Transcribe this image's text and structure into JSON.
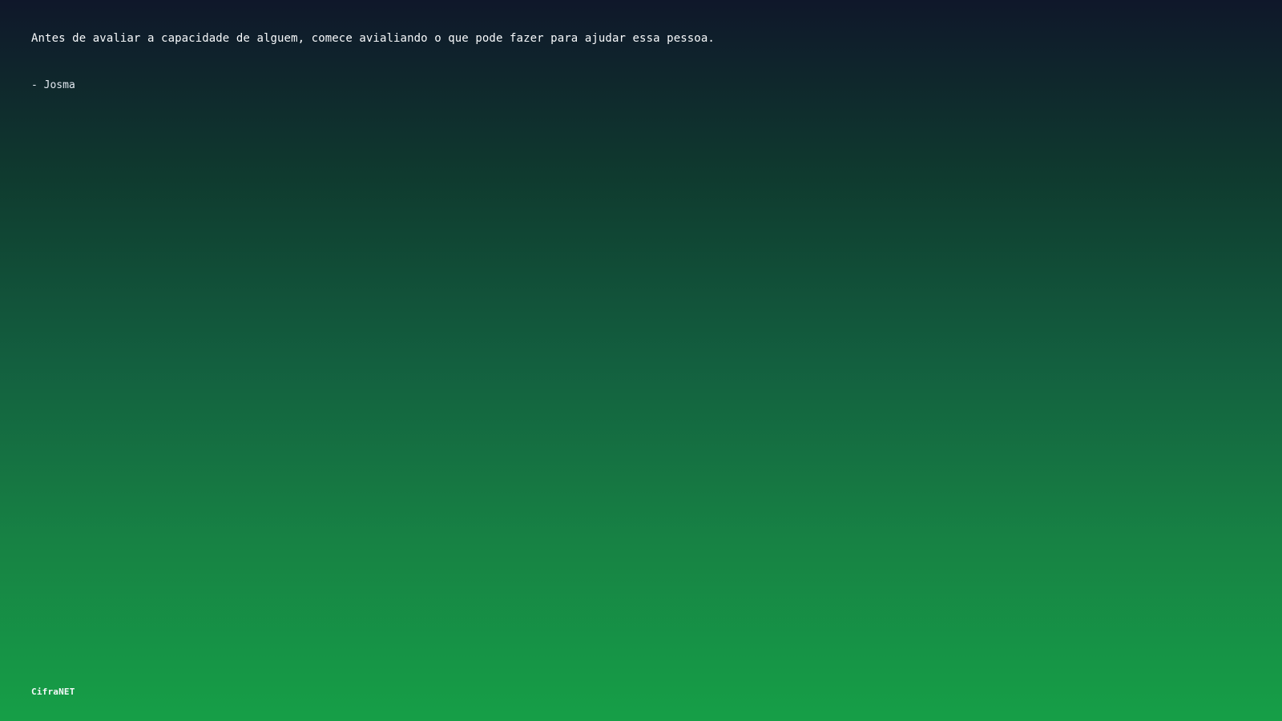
{
  "quote": {
    "text": "Antes de avaliar a capacidade de alguem, comece avialiando o que pode fazer para ajudar essa pessoa.",
    "author": "- Josma"
  },
  "footer": {
    "brand": "CifraNET"
  },
  "colors": {
    "gradient_top": "#0f172a",
    "gradient_bottom": "#169f47",
    "text": "#f8fafc"
  }
}
